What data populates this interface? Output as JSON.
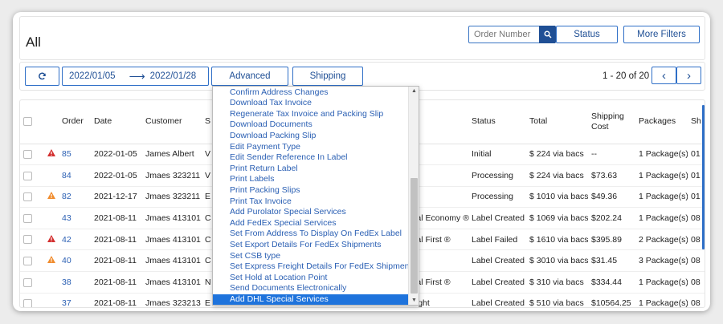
{
  "header": {
    "title": "All",
    "search_placeholder": "Order Number",
    "status_label": "Status",
    "more_filters_label": "More Filters"
  },
  "toolbar": {
    "date_from": "2022/01/05",
    "date_arrow": "⟶",
    "date_to": "2022/01/28",
    "advanced_label": "Advanced",
    "shipping_label": "Shipping",
    "pagination": "1 - 20 of 20",
    "prev": "‹",
    "next": "›"
  },
  "table": {
    "columns": [
      "Order",
      "Date",
      "Customer",
      "S",
      "Status",
      "Total",
      "Shipping Cost",
      "Packages",
      "Sh Da"
    ],
    "rows": [
      {
        "alert": "red",
        "order": "85",
        "date": "2022-01-05",
        "customer": "James Albert",
        "svc": "V",
        "svc_tail": "",
        "status": "Initial",
        "total": "$ 224 via bacs",
        "ship_cost": "--",
        "packages": "1 Package(s)",
        "shipdate": "01"
      },
      {
        "alert": "",
        "order": "84",
        "date": "2022-01-05",
        "customer": "Jmaes 323211",
        "svc": "V",
        "svc_tail": "®",
        "status": "Processing",
        "total": "$ 224 via bacs",
        "ship_cost": "$73.63",
        "packages": "1 Package(s)",
        "shipdate": "01"
      },
      {
        "alert": "orange",
        "order": "82",
        "date": "2021-12-17",
        "customer": "Jmaes 323211",
        "svc": "E",
        "svc_tail": "®",
        "status": "Processing",
        "total": "$ 1010 via bacs",
        "ship_cost": "$49.36",
        "packages": "1 Package(s)",
        "shipdate": "01"
      },
      {
        "alert": "",
        "order": "43",
        "date": "2021-08-11",
        "customer": "Jmaes 413101",
        "svc": "C",
        "svc_tail": "nal Economy ®",
        "status": "Label Created",
        "total": "$ 1069 via bacs",
        "ship_cost": "$202.24",
        "packages": "1 Package(s)",
        "shipdate": "08"
      },
      {
        "alert": "red",
        "order": "42",
        "date": "2021-08-11",
        "customer": "Jmaes 413101",
        "svc": "C",
        "svc_tail": "nal First ®",
        "status": "Label Failed",
        "total": "$ 1610 via bacs",
        "ship_cost": "$395.89",
        "packages": "2 Package(s)",
        "shipdate": "08"
      },
      {
        "alert": "orange",
        "order": "40",
        "date": "2021-08-11",
        "customer": "Jmaes 413101",
        "svc": "C",
        "svc_tail": "®",
        "status": "Label Created",
        "total": "$ 3010 via bacs",
        "ship_cost": "$31.45",
        "packages": "3 Package(s)",
        "shipdate": "08"
      },
      {
        "alert": "",
        "order": "38",
        "date": "2021-08-11",
        "customer": "Jmaes 413101",
        "svc": "N",
        "svc_tail": "nal First ®",
        "status": "Label Created",
        "total": "$ 310 via bacs",
        "ship_cost": "$334.44",
        "packages": "1 Package(s)",
        "shipdate": "08"
      },
      {
        "alert": "",
        "order": "37",
        "date": "2021-08-11",
        "customer": "Jmaes 323213",
        "svc": "E",
        "svc_tail": "eight",
        "status": "Label Created",
        "total": "$ 510 via bacs",
        "ship_cost": "$10564.25",
        "packages": "1 Package(s)",
        "shipdate": "08"
      }
    ]
  },
  "dropdown": {
    "items": [
      "Confirm Address Changes",
      "Download Tax Invoice",
      "Regenerate Tax Invoice and Packing Slip",
      "Download Documents",
      "Download Packing Slip",
      "Edit Payment Type",
      "Edit Sender Reference In Label",
      "Print Return Label",
      "Print Labels",
      "Print Packing Slips",
      "Print Tax Invoice",
      "Add Purolator Special Services",
      "Add FedEx Special Services",
      "Set From Address To Display On FedEx Label",
      "Set Export Details For FedEx Shipments",
      "Set CSB type",
      "Set Express Freight Details For FedEx Shipments",
      "Set Hold at Location Point",
      "Send Documents Electronically",
      "Add DHL Special Services"
    ],
    "selected_index": 19
  },
  "colors": {
    "accent": "#1f4f95",
    "link": "#2a5fb3",
    "selected": "#1e73dc",
    "alert_red": "#d32f2f",
    "alert_orange": "#f08c2e"
  }
}
